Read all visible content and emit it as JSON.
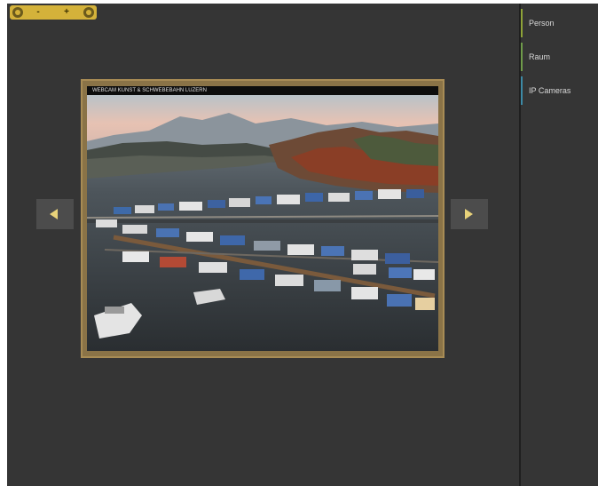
{
  "toolbar": {
    "zoom_out_icon": "zoom-out-icon",
    "minus_label": "-",
    "plus_label": "+",
    "zoom_in_icon": "zoom-in-icon"
  },
  "camera": {
    "header_text": "WEBCAM KUNST & SCHWEBEBAHN LUZERN",
    "prev_icon": "arrow-left-icon",
    "next_icon": "arrow-right-icon"
  },
  "sidebar": {
    "items": [
      {
        "label": "Person",
        "accent": "#8ea338"
      },
      {
        "label": "Raum",
        "accent": "#6f9b4a"
      },
      {
        "label": "IP Cameras",
        "accent": "#3d8aa6"
      }
    ]
  },
  "colors": {
    "background": "#353535",
    "toolbar": "#d4b23a",
    "frame": "#8a7347",
    "arrow_glyph": "#e8d27a"
  }
}
